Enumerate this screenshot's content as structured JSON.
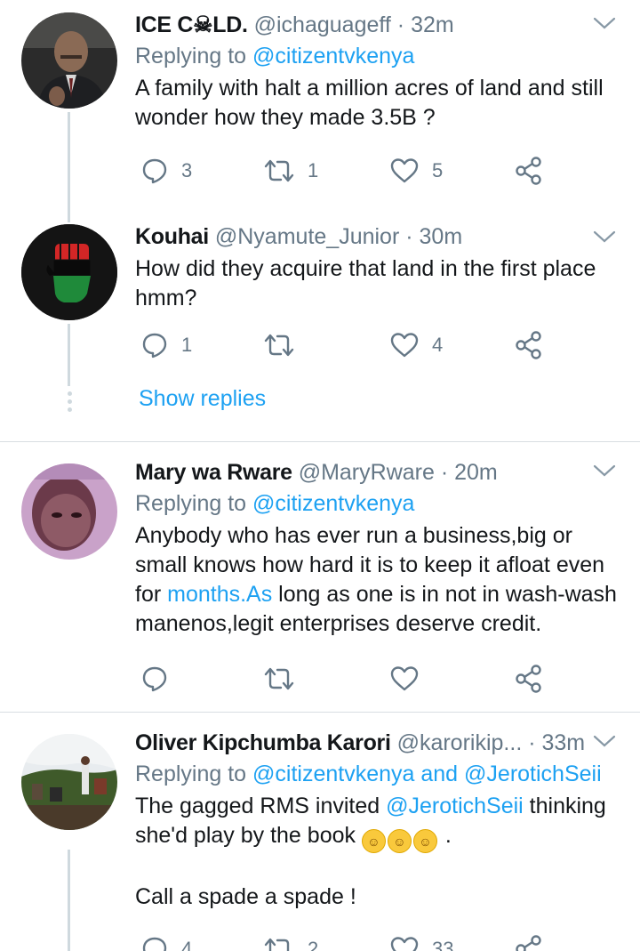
{
  "tweets": [
    {
      "name": "ICE C☠LD.",
      "handle": "@ichaguageff",
      "time": "32m",
      "replying_prefix": "Replying to ",
      "replying_to": "@citizentvkenya",
      "text": "A family with halt a million acres of land and still wonder how they made 3.5B ?",
      "replies": "3",
      "retweets": "1",
      "likes": "5"
    },
    {
      "name": "Kouhai",
      "handle": "@Nyamute_Junior",
      "time": "30m",
      "text": "How did they acquire that land in the first place hmm?",
      "replies": "1",
      "retweets": "",
      "likes": "4"
    },
    {
      "name": "Mary wa Rware",
      "handle": "@MaryRware",
      "time": "20m",
      "replying_prefix": "Replying to ",
      "replying_to": "@citizentvkenya",
      "text_a": "Anybody who has ever run a business,big or small knows how hard it is to keep it afloat even for ",
      "text_link": "months.As",
      "text_b": " long as one is in not in wash-wash manenos,legit enterprises deserve credit."
    },
    {
      "name": "Oliver Kipchumba Karori",
      "handle": "@karorikip...",
      "time": "33m",
      "replying_prefix": "Replying to ",
      "replying_to": "@citizentvkenya and @JerotichSeii",
      "text_a": "The gagged RMS invited ",
      "text_link": "@JerotichSeii",
      "text_b": " thinking she'd play by the book ",
      "text_c": " .",
      "text_2": "Call a spade a spade !",
      "replies": "4",
      "retweets": "2",
      "likes": "33"
    }
  ],
  "show_replies": "Show replies",
  "separator": "·",
  "icons": {
    "reply": "reply-icon",
    "retweet": "retweet-icon",
    "like": "heart-icon",
    "share": "share-icon",
    "chevron": "chevron-down-icon",
    "emoji": "rolling-on-floor-laughing-emoji"
  },
  "colors": {
    "link": "#1da1f2",
    "secondary": "#657786",
    "text": "#14171a",
    "divider": "#d8dee2"
  }
}
